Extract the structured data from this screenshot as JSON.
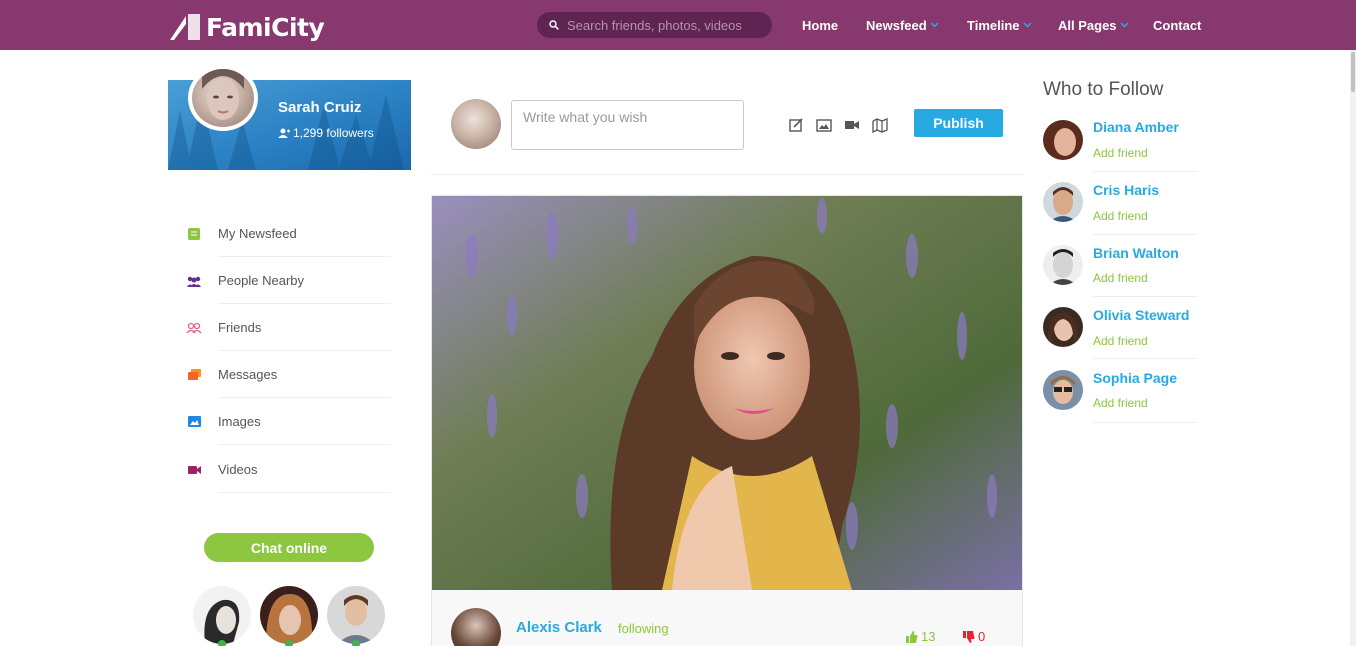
{
  "brand": {
    "name": "FamiCity",
    "primary_color": "#86386f",
    "accent_blue": "#27aae1",
    "accent_green": "#8dc63f"
  },
  "search": {
    "placeholder": "Search friends, photos, videos",
    "icon": "search-icon"
  },
  "nav": [
    {
      "label": "Home",
      "dropdown": false
    },
    {
      "label": "Newsfeed",
      "dropdown": true
    },
    {
      "label": "Timeline",
      "dropdown": true
    },
    {
      "label": "All Pages",
      "dropdown": true
    },
    {
      "label": "Contact",
      "dropdown": false
    }
  ],
  "profile": {
    "name": "Sarah Cruiz",
    "followers": "1,299 followers"
  },
  "menu": [
    {
      "label": "My Newsfeed",
      "icon": "newsfeed-icon"
    },
    {
      "label": "People Nearby",
      "icon": "people-icon"
    },
    {
      "label": "Friends",
      "icon": "friends-icon"
    },
    {
      "label": "Messages",
      "icon": "messages-icon"
    },
    {
      "label": "Images",
      "icon": "images-icon"
    },
    {
      "label": "Videos",
      "icon": "videos-icon"
    }
  ],
  "chat": {
    "button_label": "Chat online",
    "online_count": 3
  },
  "composer": {
    "placeholder": "Write what you wish",
    "tools": [
      "edit-icon",
      "image-icon",
      "video-icon",
      "map-icon"
    ],
    "publish_label": "Publish"
  },
  "post": {
    "author": "Alexis Clark",
    "status": "following",
    "likes": "13",
    "dislikes": "0"
  },
  "who_to_follow": {
    "title": "Who to Follow",
    "people": [
      {
        "name": "Diana Amber",
        "action": "Add friend"
      },
      {
        "name": "Cris Haris",
        "action": "Add friend"
      },
      {
        "name": "Brian Walton",
        "action": "Add friend"
      },
      {
        "name": "Olivia Steward",
        "action": "Add friend"
      },
      {
        "name": "Sophia Page",
        "action": "Add friend"
      }
    ]
  }
}
